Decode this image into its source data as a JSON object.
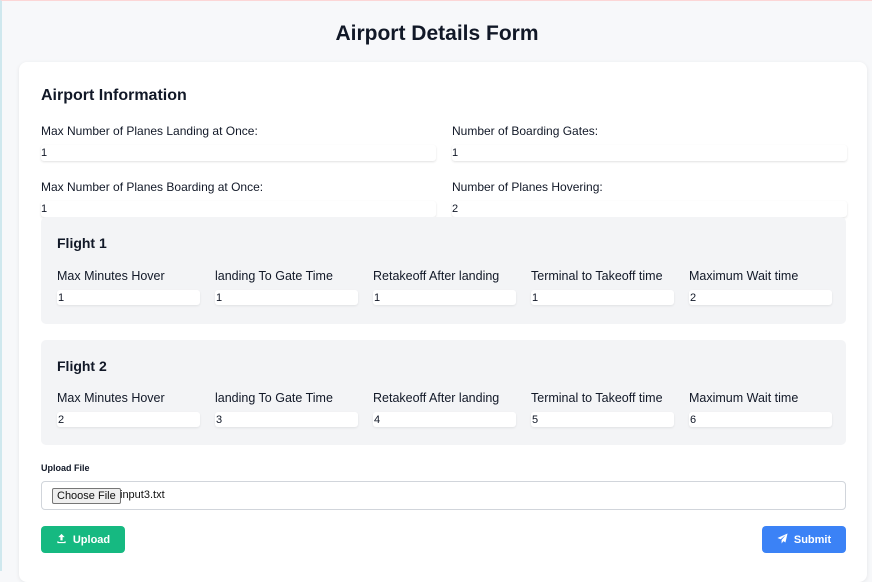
{
  "page": {
    "title": "Airport Details Form"
  },
  "airport": {
    "section_title": "Airport Information",
    "fields": {
      "max_landing": {
        "label": "Max Number of Planes Landing at Once:",
        "value": "1"
      },
      "boarding_gates": {
        "label": "Number of Boarding Gates:",
        "value": "1"
      },
      "max_boarding": {
        "label": "Max Number of Planes Boarding at Once:",
        "value": "1"
      },
      "hovering": {
        "label": "Number of Planes Hovering:",
        "value": "2"
      }
    }
  },
  "column_labels": {
    "max_hover": "Max Minutes Hover",
    "landing_to_gate": "landing To Gate Time",
    "retakeoff": "Retakeoff After landing",
    "terminal_to_takeoff": "Terminal to Takeoff time",
    "max_wait": "Maximum Wait time"
  },
  "flights": [
    {
      "title": "Flight 1",
      "values": {
        "max_hover": "1",
        "landing_to_gate": "1",
        "retakeoff": "1",
        "terminal_to_takeoff": "1",
        "max_wait": "2"
      }
    },
    {
      "title": "Flight 2",
      "values": {
        "max_hover": "2",
        "landing_to_gate": "3",
        "retakeoff": "4",
        "terminal_to_takeoff": "5",
        "max_wait": "6"
      }
    }
  ],
  "upload": {
    "label": "Upload File",
    "choose_button": "Choose File",
    "file_name": "input3.txt"
  },
  "buttons": {
    "upload": "Upload",
    "submit": "Submit"
  },
  "colors": {
    "upload_button": "#16b981",
    "submit_button": "#3b82f6",
    "flight_panel": "#f3f4f6"
  },
  "icons": {
    "upload": "upload-icon",
    "submit": "paper-plane-icon"
  }
}
